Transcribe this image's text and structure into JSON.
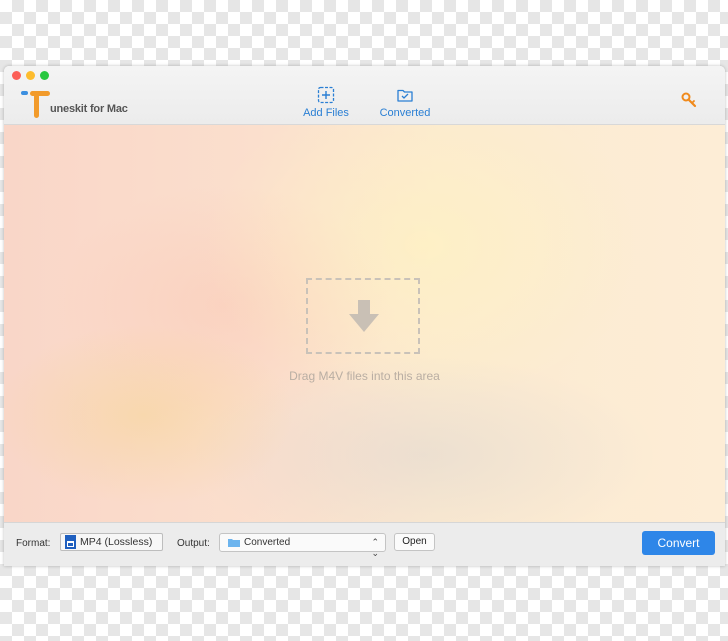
{
  "app": {
    "name": "uneskit for Mac",
    "logo_letter": "T"
  },
  "toolbar": {
    "add_files_label": "Add Files",
    "converted_label": "Converted",
    "key_icon": "key-icon"
  },
  "dropzone": {
    "hint_text": "Drag M4V files into this area",
    "icon": "download-arrow-icon"
  },
  "bottombar": {
    "format_label": "Format:",
    "format_value": "MP4 (Lossless)",
    "output_label": "Output:",
    "output_value": "Converted",
    "open_label": "Open",
    "convert_label": "Convert"
  },
  "colors": {
    "accent": "#2e86e8",
    "logo_orange": "#f29b2b",
    "logo_blue": "#3b8fe0",
    "key_orange": "#f08a1c"
  }
}
